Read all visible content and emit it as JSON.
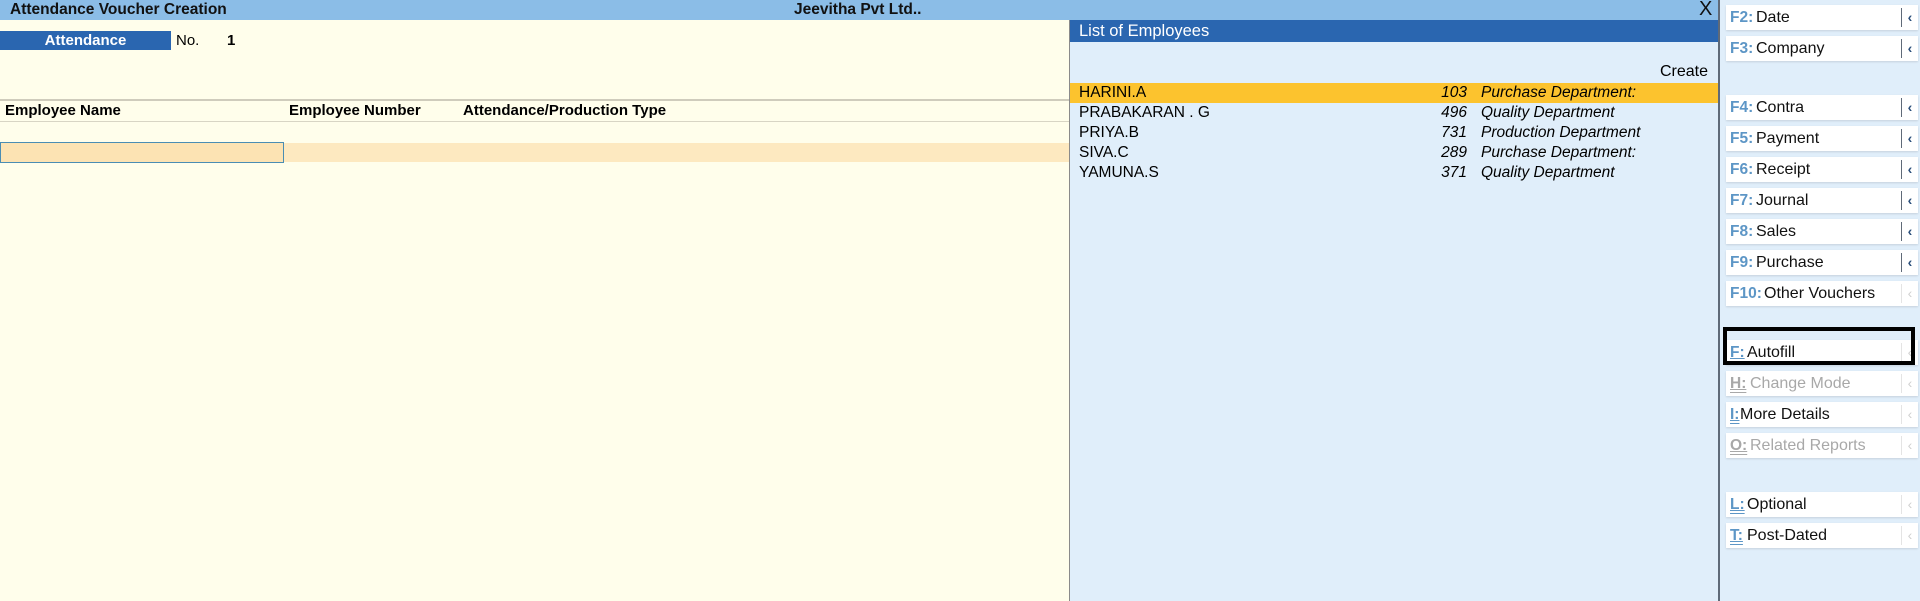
{
  "titlebar": {
    "title": "Attendance Voucher Creation",
    "company": "Jeevitha Pvt Ltd..",
    "close_glyph": "X"
  },
  "voucher": {
    "type": "Attendance",
    "number_label": "No.",
    "number": "1"
  },
  "table": {
    "columns": [
      "Employee Name",
      "Employee Number",
      "Attendance/Production Type"
    ],
    "entry": {
      "employee_name": ""
    }
  },
  "employee_list": {
    "title": "List of Employees",
    "create_label": "Create",
    "selected_index": 0,
    "items": [
      {
        "name": "HARINI.A",
        "number": "103",
        "department": "Purchase Department:"
      },
      {
        "name": "PRABAKARAN . G",
        "number": "496",
        "department": "Quality Department"
      },
      {
        "name": "PRIYA.B",
        "number": "731",
        "department": "Production Department"
      },
      {
        "name": "SIVA.C",
        "number": "289",
        "department": "Purchase Department:"
      },
      {
        "name": "YAMUNA.S",
        "number": "371",
        "department": "Quality Department"
      }
    ]
  },
  "sidebar": {
    "arrow_glyph": "‹",
    "buttons": [
      {
        "key": "F2:",
        "label": "Date",
        "state": "active"
      },
      {
        "key": "F3:",
        "label": "Company",
        "state": "active"
      },
      {
        "key": "F4:",
        "label": "Contra",
        "state": "active"
      },
      {
        "key": "F5:",
        "label": "Payment",
        "state": "active"
      },
      {
        "key": "F6:",
        "label": "Receipt",
        "state": "active"
      },
      {
        "key": "F7:",
        "label": "Journal",
        "state": "active"
      },
      {
        "key": "F8:",
        "label": "Sales",
        "state": "active"
      },
      {
        "key": "F9:",
        "label": "Purchase",
        "state": "active"
      },
      {
        "key": "F10:",
        "label": "Other Vouchers",
        "state": "inactive"
      },
      {
        "key": "F:",
        "label": "Autofill",
        "state": "inactive",
        "highlighted": true
      },
      {
        "key": "H:",
        "label": "Change Mode",
        "state": "disabled"
      },
      {
        "key": "I:",
        "label": "More Details",
        "state": "inactive"
      },
      {
        "key": "O:",
        "label": "Related Reports",
        "state": "disabled"
      },
      {
        "key": "L:",
        "label": "Optional",
        "state": "inactive"
      },
      {
        "key": "T:",
        "label": "Post-Dated",
        "state": "inactive"
      }
    ]
  },
  "colors": {
    "titlebar_bg": "#8BBDE7",
    "accent_blue": "#2A66B0",
    "selection": "#FCC32E",
    "main_bg": "#FFFEEB",
    "panel_bg": "#E0EEFA",
    "entry_row": "#FDE9C0",
    "key_blue": "#5D96C6"
  }
}
